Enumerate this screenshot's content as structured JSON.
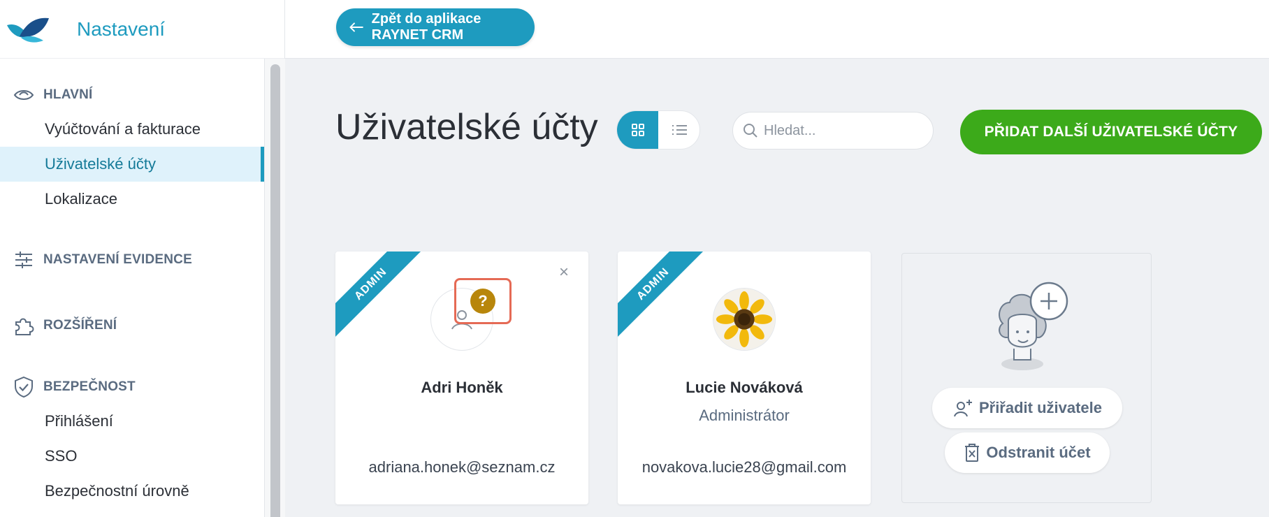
{
  "sidebar": {
    "title": "Nastavení",
    "sections": [
      {
        "label": "HLAVNÍ",
        "icon": "eye-icon",
        "items": [
          {
            "label": "Vyúčtování a fakturace"
          },
          {
            "label": "Uživatelské účty",
            "active": true
          },
          {
            "label": "Lokalizace"
          }
        ]
      },
      {
        "label": "NASTAVENÍ EVIDENCE",
        "icon": "sliders-icon",
        "items": []
      },
      {
        "label": "ROZŠÍŘENÍ",
        "icon": "puzzle-icon",
        "items": []
      },
      {
        "label": "BEZPEČNOST",
        "icon": "shield-check-icon",
        "items": [
          {
            "label": "Přihlášení"
          },
          {
            "label": "SSO"
          },
          {
            "label": "Bezpečnostní úrovně"
          }
        ]
      }
    ]
  },
  "topbar": {
    "back_label": "Zpět do aplikace RAYNET CRM"
  },
  "main": {
    "title": "Uživatelské účty",
    "view_toggle": {
      "active": "grid"
    },
    "search": {
      "placeholder": "Hledat...",
      "value": ""
    },
    "add_button": "PŘIDAT DALŠÍ UŽIVATELSKÉ ÚČTY"
  },
  "cards": [
    {
      "ribbon": "ADMIN",
      "name": "Adri Honěk",
      "role": "",
      "email": "adriana.honek@seznam.cz",
      "close": "×",
      "help": "?"
    },
    {
      "ribbon": "ADMIN",
      "name": "Lucie Nováková",
      "role": "Administrátor",
      "email": "novakova.lucie28@gmail.com"
    }
  ],
  "add_card": {
    "assign_label": "Přiřadit uživatele",
    "remove_label": "Odstranit účet"
  },
  "colors": {
    "accent": "#1e9bbf",
    "green": "#3caa1a",
    "highlight": "#e56a55",
    "help": "#b8860b"
  }
}
